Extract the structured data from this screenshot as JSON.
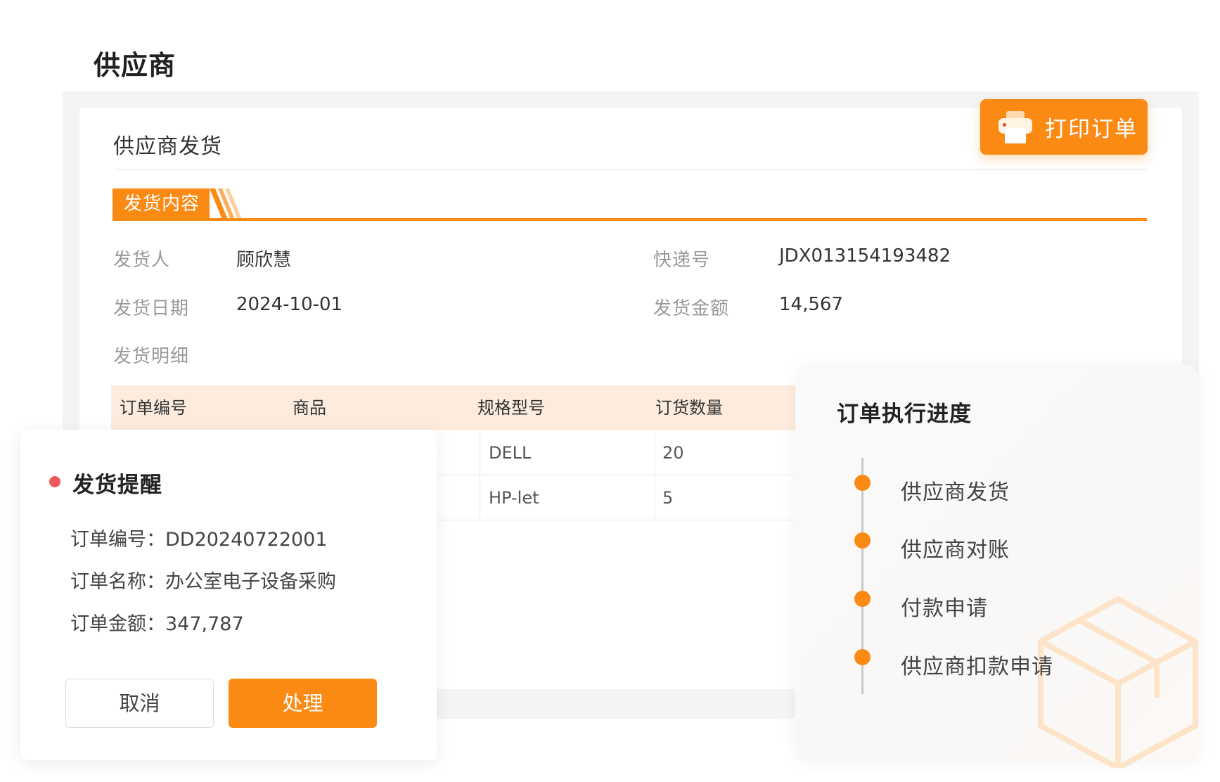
{
  "page_title": "供应商",
  "card": {
    "title": "供应商发货",
    "print_button": "打印订单",
    "section_title": "发货内容"
  },
  "fields": {
    "sender_label": "发货人",
    "sender_value": "顾欣慧",
    "tracking_label": "快递号",
    "tracking_value": "JDX013154193482",
    "date_label": "发货日期",
    "date_value": "2024-10-01",
    "amount_label": "发货金额",
    "amount_value": "14,567",
    "detail_label": "发货明细"
  },
  "table": {
    "headers": [
      "订单编号",
      "商品",
      "规格型号",
      "订货数量"
    ],
    "rows": [
      {
        "spec": "DELL",
        "qty": "20"
      },
      {
        "spec": "HP-let",
        "qty": "5"
      }
    ]
  },
  "reminder": {
    "title": "发货提醒",
    "order_no": "订单编号：DD20240722001",
    "order_name": "订单名称：办公室电子设备采购",
    "order_amount": "订单金额：347,787",
    "cancel": "取消",
    "process": "处理"
  },
  "progress": {
    "title": "订单执行进度",
    "steps": [
      "供应商发货",
      "供应商对账",
      "付款申请",
      "供应商扣款申请"
    ]
  },
  "colors": {
    "accent": "#fb8a15",
    "table_header_bg": "#fdecde",
    "alert_dot": "#f0575b"
  },
  "icons": [
    "printer-icon",
    "box-icon"
  ]
}
